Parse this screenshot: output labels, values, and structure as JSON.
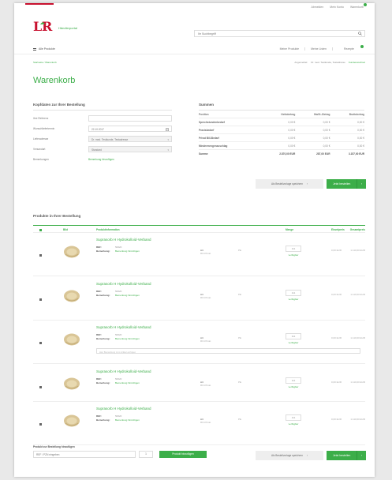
{
  "colors": {
    "accent": "#3cae49",
    "brand_red": "#c8102e"
  },
  "header": {
    "toplinks": [
      {
        "label": "Abmelden"
      },
      {
        "label": "Mein Konto"
      },
      {
        "label": "Warenkorb"
      }
    ],
    "logo_mark": "LR",
    "portal_label": "Händlerportal",
    "search_placeholder": "Ihr Suchbegriff",
    "all_products": "Alle Produkte",
    "nav": [
      {
        "label": "Meine Produkte"
      },
      {
        "label": "Meine Listen"
      },
      {
        "label": "Rezepte"
      }
    ],
    "breadcrumb_left": "Startseite / Warenkorb",
    "breadcrumb_right_label": "Angemeldet:",
    "breadcrumb_right_user": "Dr. med. Testkunde, Testadresse",
    "breadcrumb_right_link": "Kundenwechsel"
  },
  "page_title": "Warenkorb",
  "order_keys": {
    "title": "Kopfdaten zur Ihrer Bestellung",
    "rows": [
      {
        "label": "Ihre Referenz",
        "value": "",
        "type": "input"
      },
      {
        "label": "Wunschliefertermin",
        "value": "22.10.2017",
        "type": "date"
      },
      {
        "label": "Lieferadresse",
        "value": "Dr. med. Testkunde, Testadresse",
        "type": "select"
      },
      {
        "label": "Versandart",
        "value": "Standard",
        "type": "select"
      },
      {
        "label": "Bemerkungen",
        "value": "Bemerkung hinzufügen",
        "type": "link"
      }
    ]
  },
  "sums": {
    "title": "Summen",
    "headers": [
      "Position",
      "Nettobetrag",
      "MwSt.-Betrag",
      "Bruttobetrag"
    ],
    "rows": [
      [
        "Sprechstundenbedarf",
        "0,00 €",
        "0,00 €",
        "0,00 €"
      ],
      [
        "Praxisbedarf",
        "0,00 €",
        "0,00 €",
        "0,00 €"
      ],
      [
        "Privat Bill-Bedarf",
        "0,00 €",
        "0,00 €",
        "0,00 €"
      ],
      [
        "Mindermengenzuschlag",
        "0,00 €",
        "0,00 €",
        "0,00 €"
      ]
    ],
    "total": [
      "Summe",
      "2.870,00 EUR",
      "287,00 EUR",
      "3.157,00 EUR"
    ]
  },
  "actions": {
    "save_template": "Als Bestellvorlage speichern",
    "order_now": "Jetzt bestellen"
  },
  "products": {
    "title": "Produkte in Ihrer Bestellung",
    "headers": {
      "image": "Bild",
      "info": "Produktinformation",
      "qty": "Menge",
      "unit_price": "Einzelpreis",
      "total": "Gesamtpreis"
    },
    "meta_ref_label": "REF:",
    "meta_note_label": "Bemerkung:",
    "note_link": "Bemerkung hinzufügen",
    "update_label": "verfügbar",
    "art_label": "Art",
    "items": [
      {
        "name": "Suprasorb H Hydrokolloid-Verband",
        "ref": "50620",
        "art_sub": "RO-Privat",
        "unit": "PE",
        "qty": "111",
        "price": "0,00 EUR",
        "total": "1.110,00 EUR",
        "note": ""
      },
      {
        "name": "Suprasorb H Hydrokolloid-Verband",
        "ref": "50620",
        "art_sub": "RO-Privat",
        "unit": "PE",
        "qty": "111",
        "price": "0,00 EUR",
        "total": "1.110,00 EUR",
        "note": ""
      },
      {
        "name": "Suprasorb H Hydrokolloid-Verband",
        "ref": "50620",
        "art_sub": "RO-Privat",
        "unit": "PE",
        "qty": "111",
        "price": "0,00 EUR",
        "total": "1.110,00 EUR",
        "note": "Hier Bemerkung zum Artikel einfügen"
      },
      {
        "name": "Suprasorb H Hydrokolloid-Verband",
        "ref": "50620",
        "art_sub": "RO-Privat",
        "unit": "PE",
        "qty": "111",
        "price": "0,00 EUR",
        "total": "1.110,00 EUR",
        "note": ""
      },
      {
        "name": "Suprasorb H Hydrokolloid-Verband",
        "ref": "50620",
        "art_sub": "RO-Privat",
        "unit": "PE",
        "qty": "111",
        "price": "0,00 EUR",
        "total": "1.110,00 EUR",
        "note": ""
      }
    ]
  },
  "add_product": {
    "label": "Produkt zur Bestellung hinzufügen",
    "placeholder": "REF / PZN eingeben",
    "qty": "1",
    "button": "Produkt hinzufügen"
  }
}
